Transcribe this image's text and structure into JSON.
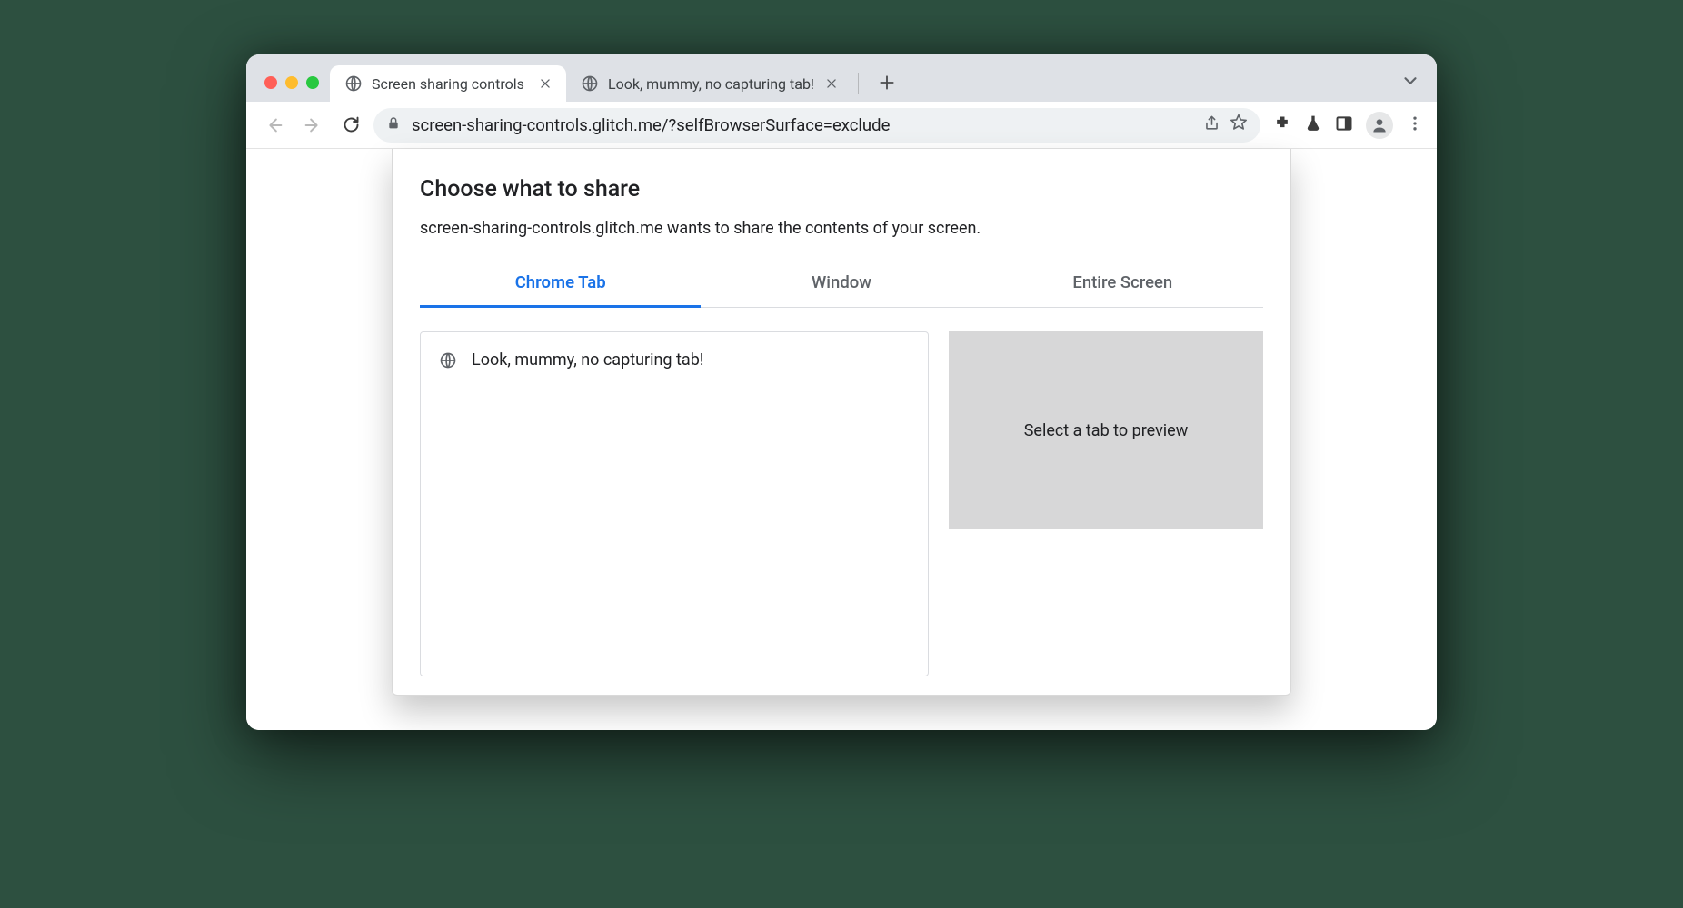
{
  "browser": {
    "tabs": [
      {
        "title": "Screen sharing controls",
        "active": true
      },
      {
        "title": "Look, mummy, no capturing tab!",
        "active": false
      }
    ]
  },
  "toolbar": {
    "url": "screen-sharing-controls.glitch.me/?selfBrowserSurface=exclude"
  },
  "dialog": {
    "title": "Choose what to share",
    "subtitle": "screen-sharing-controls.glitch.me wants to share the contents of your screen.",
    "tabs": {
      "chrome_tab": "Chrome Tab",
      "window": "Window",
      "entire_screen": "Entire Screen"
    },
    "tab_list": [
      {
        "title": "Look, mummy, no capturing tab!"
      }
    ],
    "preview_placeholder": "Select a tab to preview"
  }
}
